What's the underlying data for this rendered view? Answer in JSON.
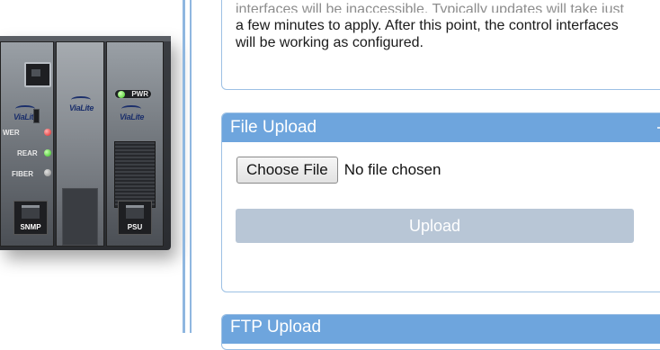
{
  "device": {
    "brand_logo": "ViaLite",
    "card1": {
      "labels": [
        "WER",
        "REAR",
        "FIBER"
      ]
    },
    "card3": {
      "pwr_label": "PWR"
    },
    "ports": [
      "SNMP",
      "PSU"
    ]
  },
  "notice": {
    "line1": "interfaces will be inaccessible. Typically updates will take just",
    "line2": "a few minutes to apply. After this point, the control interfaces",
    "line3": "will be working as configured."
  },
  "file_upload": {
    "title": "File Upload",
    "choose_label": "Choose File",
    "file_status": "No file chosen",
    "upload_label": "Upload"
  },
  "ftp_upload": {
    "title": "FTP Upload"
  },
  "colors": {
    "panel_header": "#6ea5dd",
    "panel_border": "#9cc0e4",
    "upload_disabled": "#b8c6d6"
  }
}
